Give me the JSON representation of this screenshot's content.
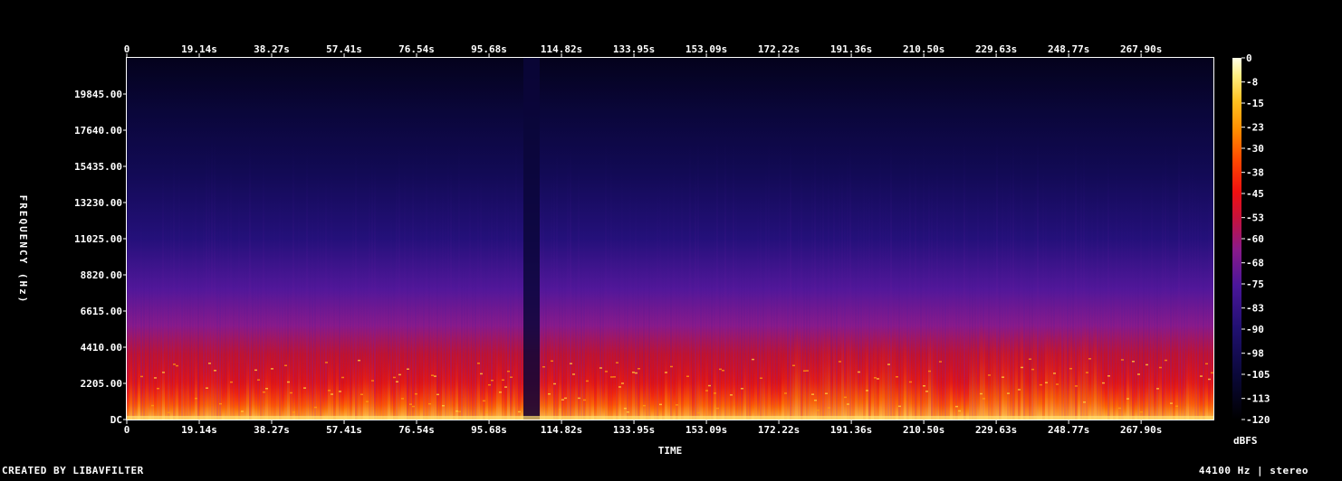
{
  "chart_data": {
    "type": "heatmap",
    "title": "",
    "xlabel": "TIME",
    "ylabel": "FREQUENCY (Hz)",
    "x_ticks": [
      "0",
      "19.14s",
      "38.27s",
      "57.41s",
      "76.54s",
      "95.68s",
      "114.82s",
      "133.95s",
      "153.09s",
      "172.22s",
      "191.36s",
      "210.50s",
      "229.63s",
      "248.77s",
      "267.90s"
    ],
    "x_tick_values": [
      0,
      19.14,
      38.27,
      57.41,
      76.54,
      95.68,
      114.82,
      133.95,
      153.09,
      172.22,
      191.36,
      210.5,
      229.63,
      248.77,
      267.9
    ],
    "xlim": [
      0,
      287.0
    ],
    "y_ticks": [
      "DC",
      "2205.00",
      "4410.00",
      "6615.00",
      "8820.00",
      "11025.00",
      "13230.00",
      "15435.00",
      "17640.00",
      "19845.00"
    ],
    "y_tick_values": [
      0,
      2205,
      4410,
      6615,
      8820,
      11025,
      13230,
      15435,
      17640,
      19845
    ],
    "ylim": [
      0,
      22050
    ],
    "colorbar": {
      "label": "dBFS",
      "ticks": [
        "0",
        "-8",
        "-15",
        "-23",
        "-30",
        "-38",
        "-45",
        "-53",
        "-60",
        "-68",
        "-75",
        "-83",
        "-90",
        "-98",
        "-105",
        "-113",
        "-120"
      ],
      "range": [
        -120,
        0
      ]
    },
    "quiet_segments_s": [
      [
        104.5,
        108.8
      ]
    ],
    "loud_segments_s": [
      [
        175.0,
        213.0
      ],
      [
        222.0,
        257.0
      ]
    ],
    "colors": {
      "background": "#000000",
      "low": "#03001a",
      "mid_low": "#3a0f7a",
      "mid": "#8a1a8a",
      "mid_high": "#e01010",
      "high": "#ff8c00",
      "peak": "#ffffd0"
    }
  },
  "footer": {
    "credit": "CREATED BY LIBAVFILTER",
    "info": "44100 Hz | stereo"
  }
}
